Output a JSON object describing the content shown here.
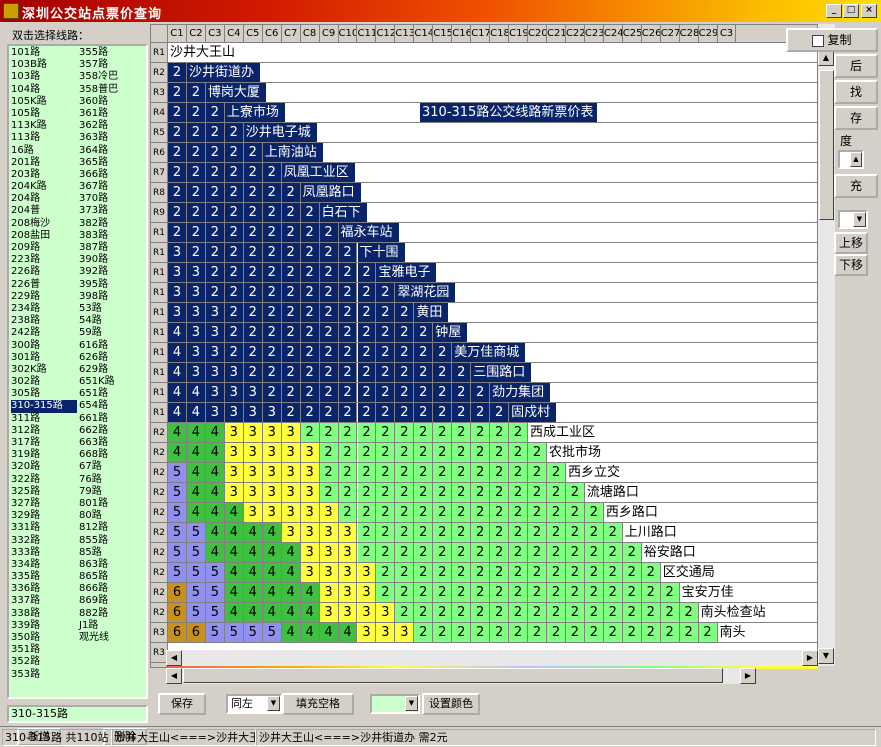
{
  "window": {
    "title": "深圳公交站点票价查询",
    "min": "_",
    "max": "□",
    "close": "×"
  },
  "left": {
    "label": "双击选择线路：",
    "routes_col1": [
      "101路",
      "103B路",
      "103路",
      "104路",
      "105K路",
      "105路",
      "113K路",
      "113路",
      "16路",
      "201路",
      "203路",
      "204K路",
      "204路",
      "204普",
      "208梅沙",
      "208盐田",
      "209路",
      "223路",
      "226路",
      "226普",
      "229路",
      "234路",
      "238路",
      "242路",
      "300路",
      "301路",
      "302K路",
      "302路",
      "305路",
      "310-315路",
      "311路",
      "312路",
      "317路",
      "319路",
      "320路",
      "322路",
      "325路",
      "327路",
      "329路",
      "331路",
      "332路",
      "333路",
      "334路",
      "335路",
      "336路",
      "337路",
      "338路",
      "339路",
      "350路",
      "351路",
      "352路",
      "353路"
    ],
    "routes_col2": [
      "355路",
      "357路",
      "358冷巴",
      "358普巴",
      "360路",
      "361路",
      "362路",
      "363路",
      "364路",
      "365路",
      "366路",
      "367路",
      "370路",
      "373路",
      "382路",
      "383路",
      "387路",
      "390路",
      "392路",
      "395路",
      "398路",
      "53路",
      "54路",
      "59路",
      "616路",
      "626路",
      "629路",
      "651K路",
      "651路",
      "654路",
      "661路",
      "662路",
      "663路",
      "668路",
      "67路",
      "76路",
      "79路",
      "801路",
      "80路",
      "812路",
      "855路",
      "85路",
      "863路",
      "865路",
      "866路",
      "869路",
      "882路",
      "J1路",
      "观光线"
    ],
    "selected": "310-315路",
    "input_value": "310-315路",
    "add_btn": "新增",
    "del_btn": "删除"
  },
  "grid": {
    "col_headers": [
      "C1",
      "C2",
      "C3",
      "C4",
      "C5",
      "C6",
      "C7",
      "C8",
      "C9",
      "C10",
      "C11",
      "C12",
      "C13",
      "C14",
      "C15",
      "C16",
      "C17",
      "C18",
      "C19",
      "C20",
      "C21",
      "C22",
      "C23",
      "C24",
      "C25",
      "C26",
      "C27",
      "C28",
      "C29",
      "C3"
    ],
    "row_headers": [
      "R1",
      "R2",
      "R3",
      "R4",
      "R5",
      "R6",
      "R7",
      "R8",
      "R9",
      "R1",
      "R1",
      "R1",
      "R1",
      "R1",
      "R1",
      "R1",
      "R1",
      "R1",
      "R1",
      "R2",
      "R2",
      "R2",
      "R2",
      "R2",
      "R2",
      "R2",
      "R2",
      "R2",
      "R2",
      "R3",
      "R3",
      "R3",
      "R3",
      "R3",
      "R3"
    ],
    "table_title": "310-315路公交线路新票价表",
    "stations": [
      "沙井大王山",
      "沙井街道办",
      "博岗大厦",
      "上寮市场",
      "沙井电子城",
      "上南油站",
      "凤凰工业区",
      "凤凰路口",
      "白石下",
      "福永车站",
      "下十围",
      "宝雅电子",
      "翠湖花园",
      "黄田",
      "钟屋",
      "美万佳商城",
      "三围路口",
      "劲力集团",
      "固戍村",
      "西成工业区",
      "农批市场",
      "西乡立交",
      "流塘路口",
      "西乡路口",
      "上川路口",
      "裕安路口",
      "区交通局",
      "宝安万佳",
      "南头检查站",
      "南头"
    ],
    "prices": [
      [],
      [
        "2"
      ],
      [
        "2",
        "2"
      ],
      [
        "2",
        "2",
        "2"
      ],
      [
        "2",
        "2",
        "2",
        "2"
      ],
      [
        "2",
        "2",
        "2",
        "2",
        "2"
      ],
      [
        "2",
        "2",
        "2",
        "2",
        "2",
        "2"
      ],
      [
        "2",
        "2",
        "2",
        "2",
        "2",
        "2",
        "2"
      ],
      [
        "2",
        "2",
        "2",
        "2",
        "2",
        "2",
        "2",
        "2"
      ],
      [
        "2",
        "2",
        "2",
        "2",
        "2",
        "2",
        "2",
        "2",
        "2"
      ],
      [
        "3",
        "2",
        "2",
        "2",
        "2",
        "2",
        "2",
        "2",
        "2",
        "2"
      ],
      [
        "3",
        "3",
        "2",
        "2",
        "2",
        "2",
        "2",
        "2",
        "2",
        "2",
        "2"
      ],
      [
        "3",
        "3",
        "2",
        "2",
        "2",
        "2",
        "2",
        "2",
        "2",
        "2",
        "2",
        "2"
      ],
      [
        "3",
        "3",
        "3",
        "2",
        "2",
        "2",
        "2",
        "2",
        "2",
        "2",
        "2",
        "2",
        "2"
      ],
      [
        "4",
        "3",
        "3",
        "2",
        "2",
        "2",
        "2",
        "2",
        "2",
        "2",
        "2",
        "2",
        "2",
        "2"
      ],
      [
        "4",
        "3",
        "3",
        "2",
        "2",
        "2",
        "2",
        "2",
        "2",
        "2",
        "2",
        "2",
        "2",
        "2",
        "2"
      ],
      [
        "4",
        "3",
        "3",
        "3",
        "2",
        "2",
        "2",
        "2",
        "2",
        "2",
        "2",
        "2",
        "2",
        "2",
        "2",
        "2"
      ],
      [
        "4",
        "4",
        "3",
        "3",
        "3",
        "2",
        "2",
        "2",
        "2",
        "2",
        "2",
        "2",
        "2",
        "2",
        "2",
        "2",
        "2"
      ],
      [
        "4",
        "4",
        "3",
        "3",
        "3",
        "3",
        "2",
        "2",
        "2",
        "2",
        "2",
        "2",
        "2",
        "2",
        "2",
        "2",
        "2",
        "2"
      ],
      [
        "4",
        "4",
        "4",
        "3",
        "3",
        "3",
        "3",
        "2",
        "2",
        "2",
        "2",
        "2",
        "2",
        "2",
        "2",
        "2",
        "2",
        "2",
        "2"
      ],
      [
        "4",
        "4",
        "4",
        "3",
        "3",
        "3",
        "3",
        "3",
        "2",
        "2",
        "2",
        "2",
        "2",
        "2",
        "2",
        "2",
        "2",
        "2",
        "2",
        "2"
      ],
      [
        "5",
        "4",
        "4",
        "3",
        "3",
        "3",
        "3",
        "3",
        "2",
        "2",
        "2",
        "2",
        "2",
        "2",
        "2",
        "2",
        "2",
        "2",
        "2",
        "2",
        "2"
      ],
      [
        "5",
        "4",
        "4",
        "3",
        "3",
        "3",
        "3",
        "3",
        "2",
        "2",
        "2",
        "2",
        "2",
        "2",
        "2",
        "2",
        "2",
        "2",
        "2",
        "2",
        "2",
        "2"
      ],
      [
        "5",
        "4",
        "4",
        "4",
        "3",
        "3",
        "3",
        "3",
        "3",
        "2",
        "2",
        "2",
        "2",
        "2",
        "2",
        "2",
        "2",
        "2",
        "2",
        "2",
        "2",
        "2",
        "2"
      ],
      [
        "5",
        "5",
        "4",
        "4",
        "4",
        "4",
        "3",
        "3",
        "3",
        "3",
        "2",
        "2",
        "2",
        "2",
        "2",
        "2",
        "2",
        "2",
        "2",
        "2",
        "2",
        "2",
        "2",
        "2"
      ],
      [
        "5",
        "5",
        "4",
        "4",
        "4",
        "4",
        "4",
        "3",
        "3",
        "3",
        "2",
        "2",
        "2",
        "2",
        "2",
        "2",
        "2",
        "2",
        "2",
        "2",
        "2",
        "2",
        "2",
        "2",
        "2"
      ],
      [
        "5",
        "5",
        "5",
        "4",
        "4",
        "4",
        "4",
        "3",
        "3",
        "3",
        "3",
        "2",
        "2",
        "2",
        "2",
        "2",
        "2",
        "2",
        "2",
        "2",
        "2",
        "2",
        "2",
        "2",
        "2",
        "2"
      ],
      [
        "6",
        "5",
        "5",
        "4",
        "4",
        "4",
        "4",
        "4",
        "3",
        "3",
        "3",
        "2",
        "2",
        "2",
        "2",
        "2",
        "2",
        "2",
        "2",
        "2",
        "2",
        "2",
        "2",
        "2",
        "2",
        "2",
        "2"
      ],
      [
        "6",
        "5",
        "5",
        "4",
        "4",
        "4",
        "4",
        "4",
        "3",
        "3",
        "3",
        "3",
        "2",
        "2",
        "2",
        "2",
        "2",
        "2",
        "2",
        "2",
        "2",
        "2",
        "2",
        "2",
        "2",
        "2",
        "2",
        "2"
      ],
      [
        "6",
        "6",
        "5",
        "5",
        "5",
        "5",
        "4",
        "4",
        "4",
        "4",
        "3",
        "3",
        "3",
        "2",
        "2",
        "2",
        "2",
        "2",
        "2",
        "2",
        "2",
        "2",
        "2",
        "2",
        "2",
        "2",
        "2",
        "2",
        "2"
      ]
    ],
    "colors": {
      "2": "#80ff80",
      "3": "#ffff40",
      "4": "#40c040",
      "5": "#9090f0",
      "6": "#c89020",
      "sel": "#0a246a"
    }
  },
  "right": {
    "copy": "复制",
    "b2": "后",
    "b3": "找",
    "b4": "存",
    "degree": "度",
    "b6": "充",
    "up": "上移",
    "down": "下移"
  },
  "bottom": {
    "save": "保存",
    "align": "同左",
    "fill": "填充空格",
    "color_combo": "",
    "set_color": "设置颜色"
  },
  "status": {
    "p1": "310-315路  共110站",
    "p2": "沙井大王山<===>沙井大王",
    "p3": "沙井大王山<===>沙井街道办  需2元"
  }
}
